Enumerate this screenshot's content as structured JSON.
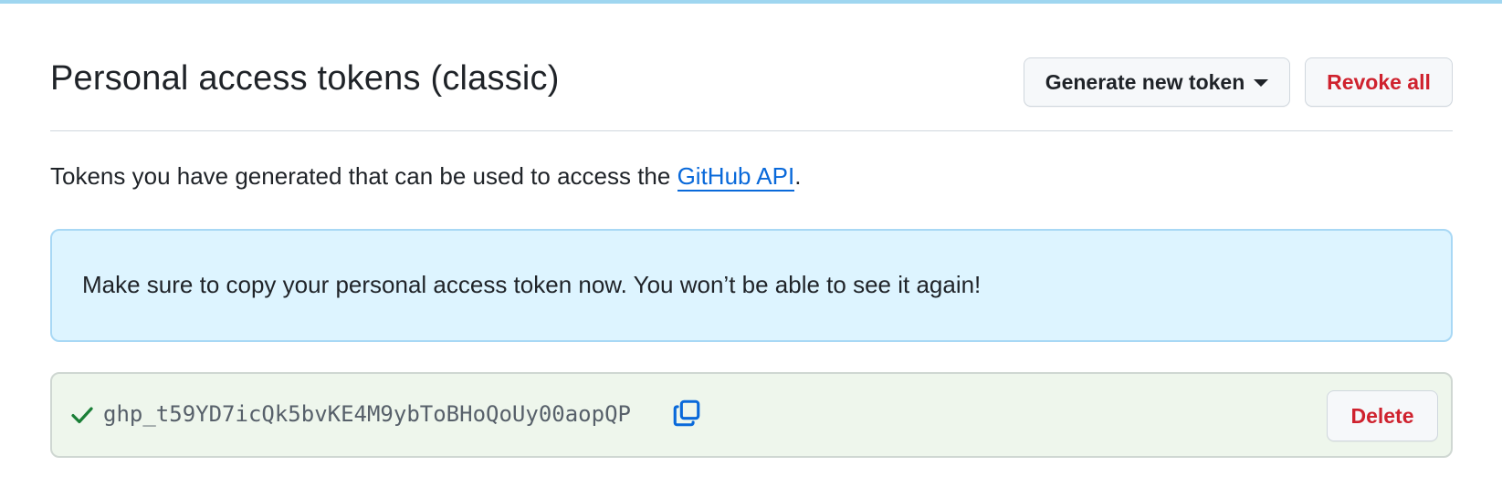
{
  "header": {
    "title": "Personal access tokens (classic)",
    "generate_label": "Generate new token",
    "revoke_label": "Revoke all"
  },
  "intro": {
    "prefix": "Tokens you have generated that can be used to access the ",
    "link_text": "GitHub API",
    "suffix": "."
  },
  "flash": {
    "message": "Make sure to copy your personal access token now. You won’t be able to see it again!"
  },
  "token": {
    "value": "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",
    "delete_label": "Delete",
    "status_icon": "check-icon",
    "copy_icon": "copy-icon"
  },
  "colors": {
    "accent_link": "#0969da",
    "danger": "#cf222e",
    "flash_bg": "#ddf4ff",
    "token_bg": "#eef6ec",
    "success": "#1a7f37"
  }
}
